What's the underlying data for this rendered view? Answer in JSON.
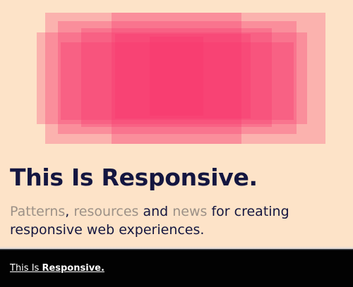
{
  "headline": {
    "text": "This Is Responsive."
  },
  "tagline": {
    "link_patterns": "Patterns",
    "comma": ", ",
    "link_resources": "resources",
    "and": " and ",
    "link_news": "news",
    "rest": " for creating responsive web experiences."
  },
  "footer_bar": {
    "title_prefix": "This Is ",
    "title_strong": "Responsive."
  },
  "colors": {
    "background": "#fde3c8",
    "accent": "#f8346a",
    "text_dark": "#141640",
    "link_muted": "#9c9187",
    "bar": "#020202"
  }
}
